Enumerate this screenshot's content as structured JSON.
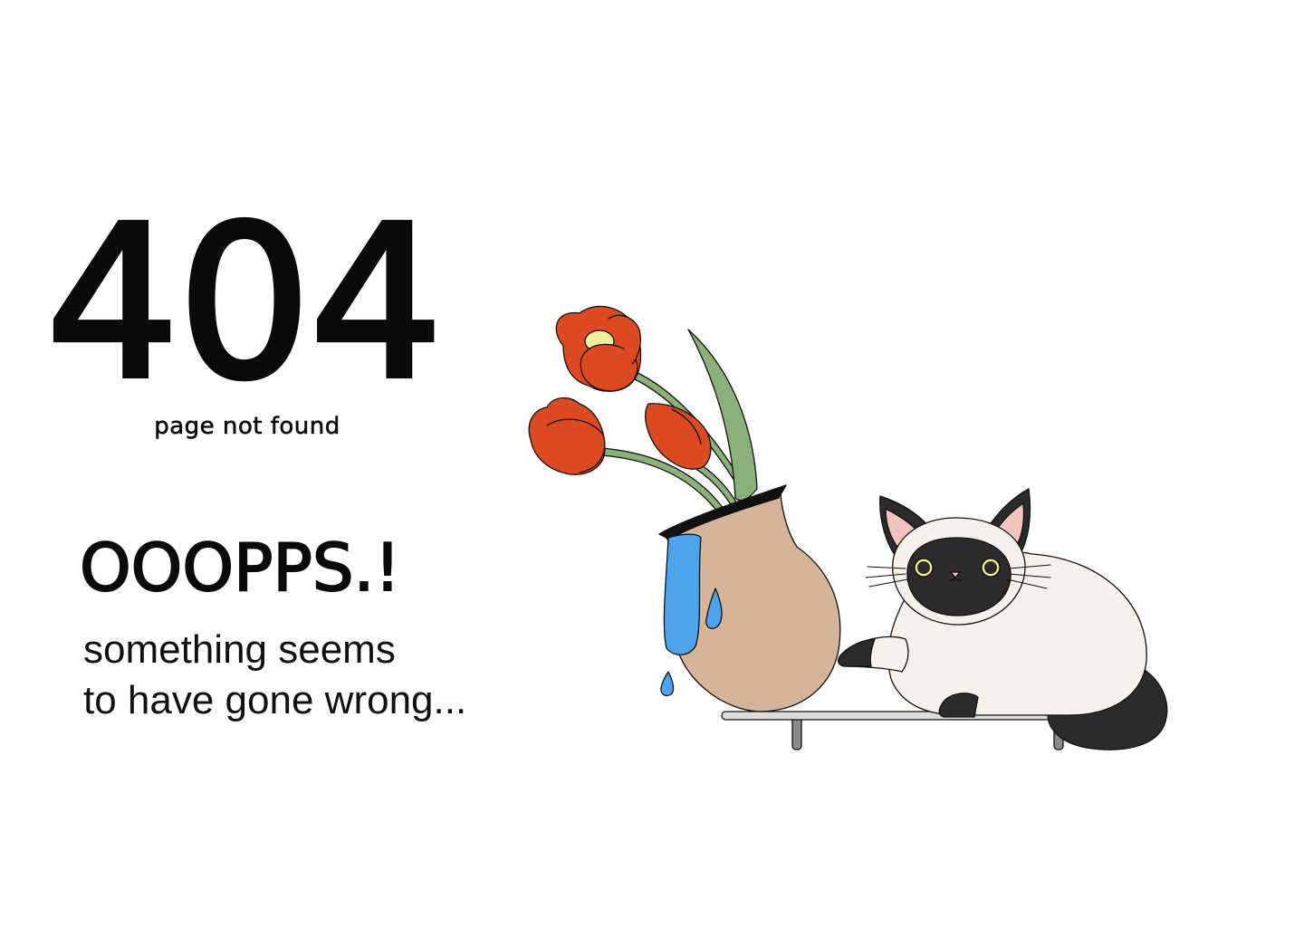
{
  "error": {
    "code": "404",
    "subtitle": "page not found"
  },
  "message": {
    "headline": "OOOPPS.!",
    "line1": "something seems",
    "line2": "to have gone wrong..."
  },
  "colors": {
    "background": "#ffffff",
    "text": "#0a0a0a",
    "tulip_red": "#dc4a22",
    "stem_green": "#8cb07a",
    "vase_tan": "#d6b497",
    "water_blue": "#4ea3ee",
    "cat_cream": "#f6f2ea",
    "cat_dark": "#2b2b2b",
    "ear_pink": "#f2c4bd",
    "eye_yellow": "#f1ee8e",
    "shelf_grey": "#dcdcdc"
  }
}
